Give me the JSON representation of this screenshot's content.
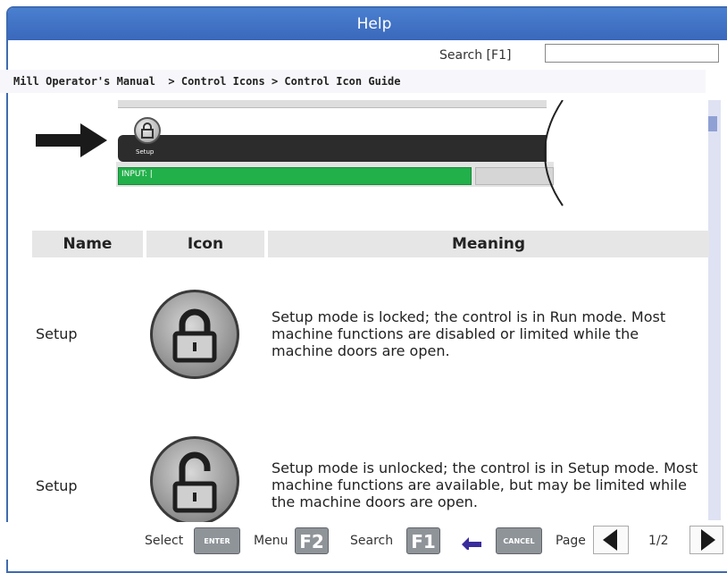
{
  "window": {
    "title": "Help"
  },
  "search": {
    "label": "Search [F1]",
    "value": ""
  },
  "breadcrumb": "Mill Operator's Manual  > Control Icons > Control Icon Guide",
  "illustration": {
    "setup_label": "Setup",
    "input_label": "INPUT: |"
  },
  "table": {
    "headers": {
      "name": "Name",
      "icon": "Icon",
      "meaning": "Meaning"
    },
    "rows": [
      {
        "name": "Setup",
        "icon": "lock-closed-icon",
        "meaning": "Setup mode is locked; the control is in Run mode. Most machine functions are disabled or limited while the machine doors are open."
      },
      {
        "name": "Setup",
        "icon": "lock-open-icon",
        "meaning": "Setup mode is unlocked; the control is in Setup mode. Most machine functions are available, but may be limited while the machine doors are open."
      }
    ]
  },
  "toolbar": {
    "select_label": "Select",
    "enter_key": "ENTER",
    "menu_label": "Menu",
    "menu_key": "F2",
    "search_label": "Search",
    "search_key": "F1",
    "cancel_key": "CANCEL",
    "page_label": "Page",
    "page_value": "1/2"
  },
  "colors": {
    "titlebar": "#3a68bb",
    "input_bar": "#22b04a",
    "key": "#8f9499"
  }
}
